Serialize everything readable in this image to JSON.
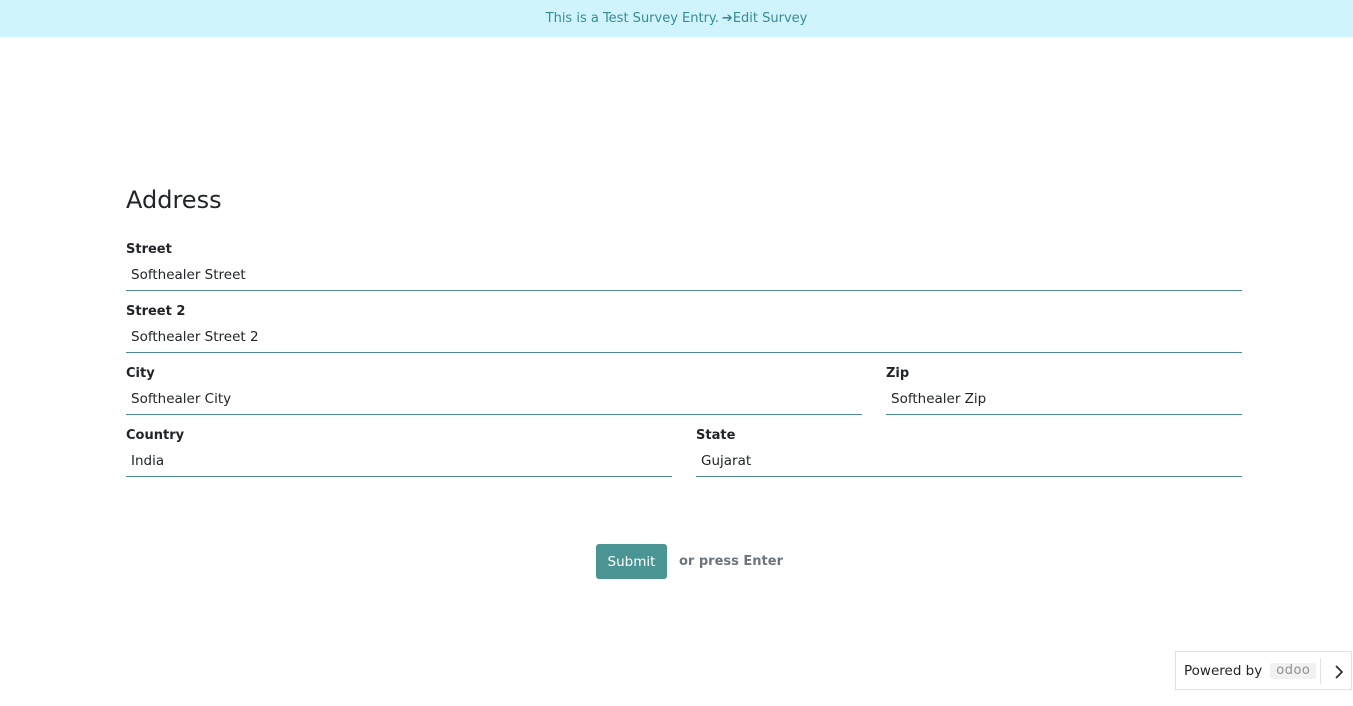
{
  "banner": {
    "text": "This is a Test Survey Entry.",
    "arrow": "➔",
    "link_label": "Edit Survey"
  },
  "page": {
    "title": "Address"
  },
  "fields": {
    "street": {
      "label": "Street",
      "value": "Softhealer Street"
    },
    "street2": {
      "label": "Street 2",
      "value": "Softhealer Street 2"
    },
    "city": {
      "label": "City",
      "value": "Softhealer City"
    },
    "zip": {
      "label": "Zip",
      "value": "Softhealer Zip"
    },
    "country": {
      "label": "Country",
      "value": "India"
    },
    "state": {
      "label": "State",
      "value": "Gujarat"
    }
  },
  "actions": {
    "submit_label": "Submit",
    "hint": "or press Enter"
  },
  "footer": {
    "powered_by": "Powered by",
    "logo_text": "odoo",
    "chevron_icon": "chevron-right-icon"
  },
  "colors": {
    "banner_bg": "#cff4fc",
    "accent": "#4a9593",
    "input_border": "#4d8a95"
  }
}
